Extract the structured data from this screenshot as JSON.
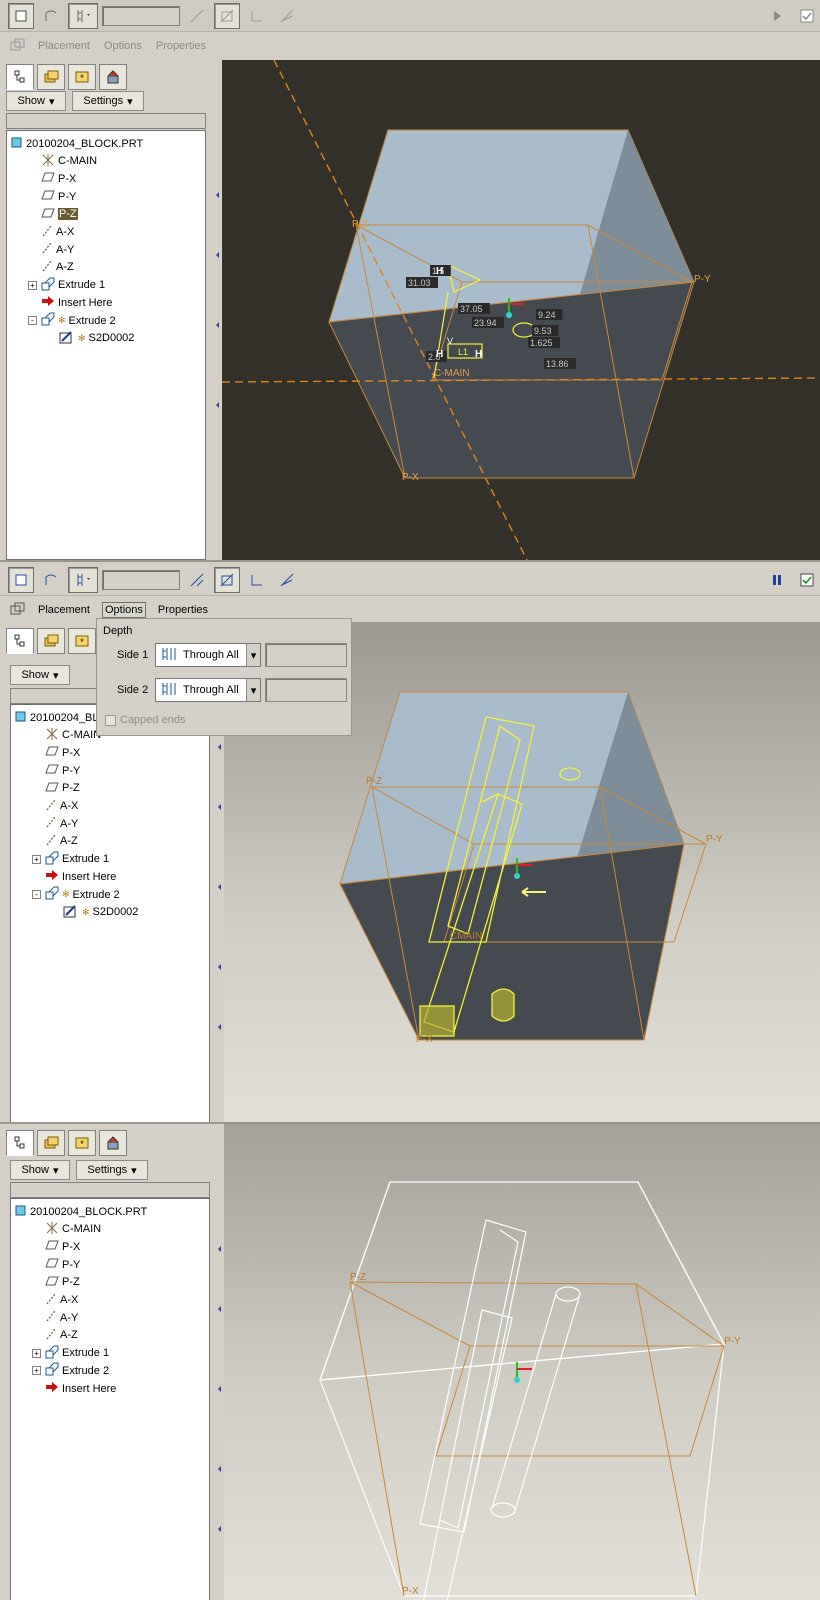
{
  "app": {
    "tabs": {
      "placement": "Placement",
      "options": "Options",
      "properties": "Properties"
    },
    "show_label": "Show",
    "settings_label": "Settings",
    "options_panel": {
      "depth_label": "Depth",
      "side1_label": "Side 1",
      "side2_label": "Side 2",
      "side1_value": "Through All",
      "side2_value": "Through All",
      "capped_label": "Capped ends"
    }
  },
  "tree_a": [
    "20100204_BLOCK.PRT",
    "C-MAIN",
    "P-X",
    "P-Y",
    "P-Z",
    "A-X",
    "A-Y",
    "A-Z",
    "Extrude 1",
    "Insert Here",
    "Extrude 2",
    "S2D0002"
  ],
  "tree_b": [
    "20100204_BL",
    "C-MAIN",
    "P-X",
    "P-Y",
    "P-Z",
    "A-X",
    "A-Y",
    "A-Z",
    "Extrude 1",
    "Insert Here",
    "Extrude 2",
    "S2D0002"
  ],
  "tree_c": [
    "20100204_BLOCK.PRT",
    "C-MAIN",
    "P-X",
    "P-Y",
    "P-Z",
    "A-X",
    "A-Y",
    "A-Z",
    "Extrude 1",
    "Extrude 2",
    "Insert Here"
  ],
  "viewport_labels": {
    "pz": "P-Z",
    "py": "P-Y",
    "px": "P-X",
    "cmain": "C-MAIN",
    "cmain2": "CMAIN",
    "dims": [
      "31.03",
      "37.05",
      "23.94",
      "9.24",
      "9.53",
      "1.625",
      "13.86",
      "1.5",
      "2.0"
    ],
    "sketch_letters": {
      "h": "H",
      "v": "V",
      "l": "L1"
    }
  },
  "colors": {
    "ui_gray": "#d4d0c8",
    "dark_viewport": "#333129",
    "datum_orange": "#c07a1e",
    "sketch_yellow": "#f2f23a",
    "cube_light": "#a9bccb",
    "cube_dark": "#454a50"
  }
}
